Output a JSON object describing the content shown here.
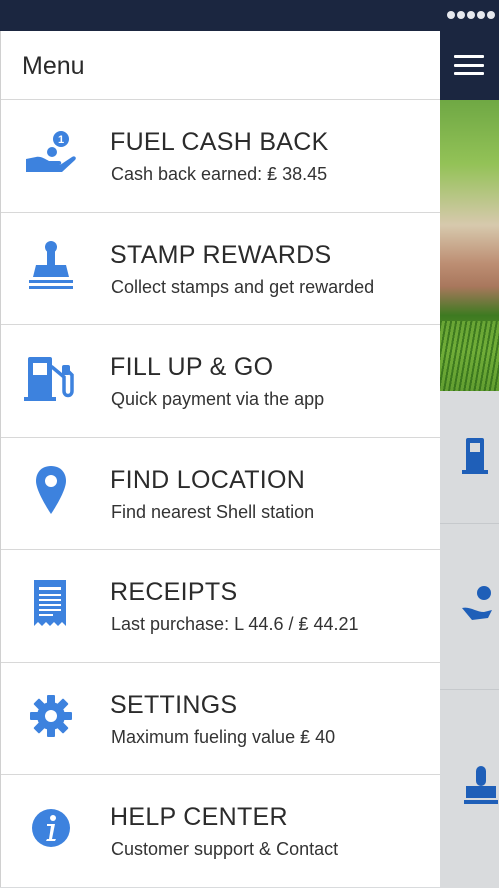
{
  "colors": {
    "accent": "#3d82de",
    "header_bg": "#1b2640",
    "divider": "#d8d8d8"
  },
  "menu": {
    "title": "Menu",
    "items": [
      {
        "title": "FUEL CASH BACK",
        "subtitle": "Cash back earned: ₤ 38.45",
        "icon": "cash-back-hand-icon"
      },
      {
        "title": "STAMP REWARDS",
        "subtitle": "Collect stamps and get rewarded",
        "icon": "stamp-icon"
      },
      {
        "title": "FILL UP & GO",
        "subtitle": "Quick payment via the app",
        "icon": "fuel-pump-icon"
      },
      {
        "title": "FIND LOCATION",
        "subtitle": "Find nearest Shell station",
        "icon": "location-pin-icon"
      },
      {
        "title": "RECEIPTS",
        "subtitle": "Last purchase: L 44.6 / ₤ 44.21",
        "icon": "receipt-icon"
      },
      {
        "title": "SETTINGS",
        "subtitle": "Maximum fueling value ₤ 40",
        "icon": "gear-icon"
      },
      {
        "title": "HELP CENTER",
        "subtitle": "Customer support & Contact",
        "icon": "info-icon"
      }
    ]
  }
}
